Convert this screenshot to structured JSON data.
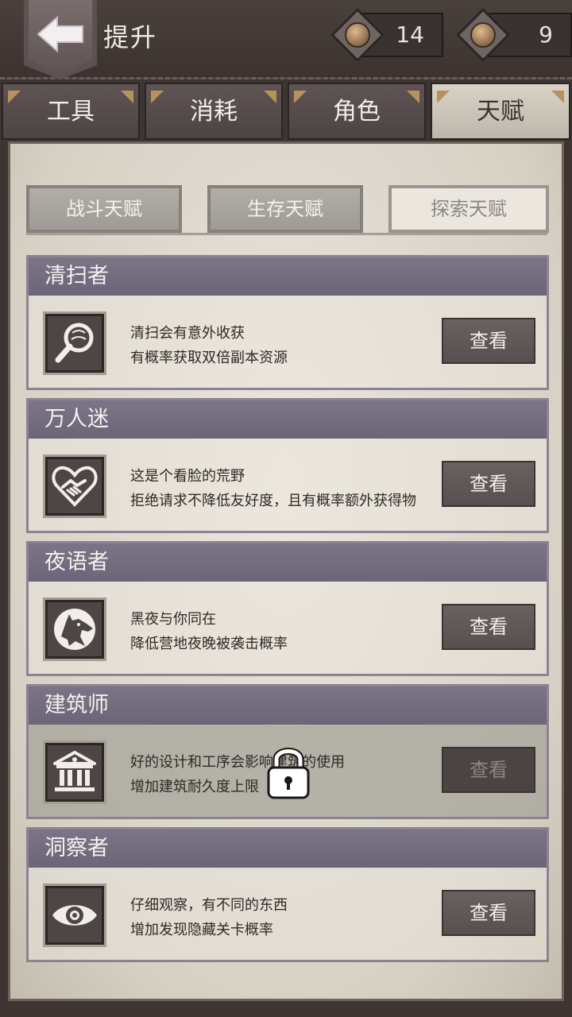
{
  "header": {
    "title": "提升",
    "currency_a": "14",
    "currency_b": "9"
  },
  "tabs": [
    {
      "label": "工具",
      "active": false
    },
    {
      "label": "消耗",
      "active": false
    },
    {
      "label": "角色",
      "active": false
    },
    {
      "label": "天赋",
      "active": true
    }
  ],
  "subtabs": [
    {
      "label": "战斗天赋",
      "active": false
    },
    {
      "label": "生存天赋",
      "active": false
    },
    {
      "label": "探索天赋",
      "active": true
    }
  ],
  "talents": [
    {
      "name": "清扫者",
      "icon": "magnifier-icon",
      "line1": "清扫会有意外收获",
      "line2": "有概率获取双倍副本资源",
      "button": "查看",
      "locked": false
    },
    {
      "name": "万人迷",
      "icon": "heart-handshake-icon",
      "line1": "这是个看脸的荒野",
      "line2": "拒绝请求不降低友好度，且有概率额外获得物",
      "button": "查看",
      "locked": false
    },
    {
      "name": "夜语者",
      "icon": "wolf-icon",
      "line1": "黑夜与你同在",
      "line2": "降低营地夜晚被袭击概率",
      "button": "查看",
      "locked": false
    },
    {
      "name": "建筑师",
      "icon": "building-icon",
      "line1": "好的设计和工序会影响建筑的使用",
      "line2": "增加建筑耐久度上限",
      "button": "查看",
      "locked": true
    },
    {
      "name": "洞察者",
      "icon": "eye-icon",
      "line1": "仔细观察，有不同的东西",
      "line2": "增加发现隐藏关卡概率",
      "button": "查看",
      "locked": false
    }
  ]
}
